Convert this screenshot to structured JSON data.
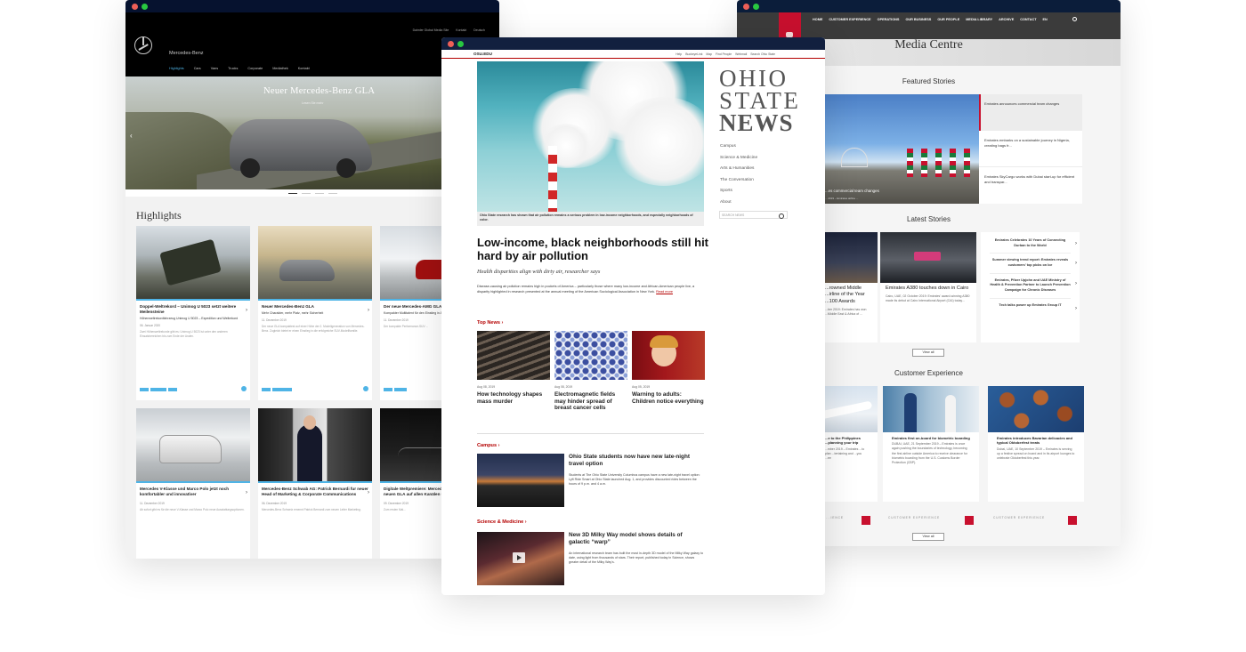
{
  "mercedes": {
    "brand": "Mercedes-Benz",
    "top_links": [
      "Daimler Global Media Site",
      "Kontakt",
      "Deutsch"
    ],
    "nav": [
      "Highlights",
      "Cars",
      "Vans",
      "Trucks",
      "Corporate",
      "Mediathek",
      "Kontakt"
    ],
    "hero_title": "Neuer Mercedes-Benz GLA",
    "hero_sub": "Lesen Sie mehr",
    "highlights_heading": "Highlights",
    "cards": [
      {
        "title": "Doppel-Weltrekord – Unimog U 5023 setzt weitere Meilensteine",
        "sub": "Höhenweltrekordfahrzeug Unimog U 5023 – Expedition und Weltrekord",
        "date": "06. Januar 2020",
        "text": "Zwei Höhenweltrekorde gibt es: Unimog U 5023 ist unter den anderen Einsatzbereichen bis zum Ende der Anden."
      },
      {
        "title": "Neuer Mercedes-Benz GLA",
        "sub": "Mehr Charakter, mehr Platz, mehr Sicherheit",
        "date": "11. Dezember 2019",
        "text": "Der neue GLA kompaktest auf einer Höhe der 2. Modellgeneration von Mercedes-Benz. Zugleich bietet er einen Einstieg in die erfolgreiche SUV-Modellfamilie."
      },
      {
        "title": "Der neue Mercedes-AMG GLA",
        "sub": "Kompakter Multitalent für den Einstieg in AMG Welt",
        "date": "11. Dezember 2019",
        "text": "Der kompakte Performance-SUV ..."
      },
      {
        "title": "Mercedes V-Klasse und Marco Polo jetzt noch komfortabler und innovativer",
        "sub": "",
        "date": "11. Dezember 2019",
        "text": "Ab sofort gibt es für die neue V-Klasse und Marco Polo neue Ausstattungsoptionen."
      },
      {
        "title": "Mercedes-Benz Schwab AG: Patrick Bernardi fur neuer Head of Marketing & Corporate Communications",
        "sub": "",
        "date": "06. Dezember 2019",
        "text": "Mercedes-Benz Schweiz ernennt Patrick Bernardi zum neuen Leiter Marketing."
      },
      {
        "title": "Digitale Weltpremiere: Mercedes-Benz präsentiert neuen GLA auf allen Kanälen und Social media",
        "sub": "",
        "date": "09. Dezember 2019",
        "text": "Zum ersten Mal..."
      }
    ]
  },
  "osu": {
    "topbar_label": "OSU.EDU",
    "top_links": [
      "Help",
      "BuckeyeLink",
      "Map",
      "Find People",
      "Webmail",
      "Search Ohio State"
    ],
    "logo": [
      "OHIO",
      "STATE",
      "NEWS"
    ],
    "menu": [
      "Campus",
      "Science & Medicine",
      "Arts & Humanities",
      "The Conversation",
      "Sports",
      "About"
    ],
    "search_placeholder": "SEARCH NEWS",
    "hero_caption": "Ohio State research has shown that air pollution remains a serious problem in low-income neighborhoods, and especially neighborhoods of color.",
    "headline": "Low-income, black neighborhoods still hit hard by air pollution",
    "dek": "Health disparities align with dirty air, researcher says",
    "body": "Disease-causing air pollution remains high in pockets of America – particularly those where many low-income and African-American people live, a disparity highlighted in research presented at the annual meeting of the American Sociological Association in New York.",
    "read_more": "Read more",
    "top_news_label": "Top News ›",
    "top_news": [
      {
        "date": "Aug 08, 2019",
        "title": "How technology shapes mass murder"
      },
      {
        "date": "Aug 08, 2019",
        "title": "Electromagnetic fields may hinder spread of breast cancer cells"
      },
      {
        "date": "Aug 05, 2019",
        "title": "Warning to adults: Children notice everything"
      }
    ],
    "campus_label": "Campus ›",
    "campus_story": {
      "title": "Ohio State students now have new late-night travel option",
      "text": "Students at The Ohio State University Columbus campus have a new late-night travel option: Lyft Ride Smart at Ohio State launched Aug. 1, and provides discounted rides between the hours of 9 p.m. and 4 a.m."
    },
    "science_label": "Science & Medicine ›",
    "science_story": {
      "title": "New 3D Milky Way model shows details of galactic “warp”",
      "text": "An international research team has built the most in-depth 3D model of the Milky Way galaxy to date, using light from thousands of stars. Their report, published today in Science, shows greater detail of the Milky Way's."
    }
  },
  "emirates": {
    "nav": [
      "HOME",
      "CUSTOMER EXPERIENCE",
      "OPERATIONS",
      "OUR BUSINESS",
      "OUR PEOPLE",
      "MEDIA LIBRARY",
      "ARCHIVE",
      "CONTACT",
      "EN"
    ],
    "page_title": "Media Centre",
    "featured_heading": "Featured Stories",
    "featured_caption": "...es commercial team changes",
    "featured_date": "... 2019 – Emirates airline ...",
    "featured_list": [
      "Emirates announces commercial team changes",
      "Emirates embarks on a sustainable journey in Nigeria, creating bags fr...",
      "Emirates SkyCargo works with Dubai start-up for efficient and transpar..."
    ],
    "latest_heading": "Latest Stories",
    "latest_cards": [
      {
        "title": "...rowned Middle ...irline of the Year ...100 Awards",
        "text": "...ber 2019: Emirates has won ...Middle East & Africa of ..."
      },
      {
        "title": "Emirates A380 touches down in Cairo",
        "text": "Cairo, UAE, 02 October 2019: Emirates' award-winning A380 made its debut at Cairo International Airport (CAI) today..."
      }
    ],
    "latest_list": [
      "Emirates Celebrates 10 Years of Connecting Durban to the World",
      "Summer viewing trend report: Emirates reveals customers' top picks on Ice",
      "Emirates, Pfizer Upjohn and UAE Ministry of Health & Prevention Partner to Launch Prevention Campaign for Chronic Diseases",
      "Tech talks power up Emirates Group IT"
    ],
    "view_all": "View all",
    "customer_heading": "Customer Experience",
    "customer_cards": [
      {
        "title": "...e to the Philippines ...planning your trip",
        "text": "...mber 2019 – Emirates ...to plan ...tertaining and ...you ...ee"
      },
      {
        "title": "Emirates first on-board for biometric boarding",
        "text": "DUBAI, UAE, 21 September 2019 – Emirates is once again pushing the boundaries of technology, becoming the first airline outside America to receive clearance for biometric boarding from the U.S. Customs Border Protection (CBP)."
      },
      {
        "title": "Emirates introduces Bavarian delicacies and typical Oktoberfest treats",
        "text": "Dubai, UAE, 10 September 2019 – Emirates is serving up a festive spread on board and in its airport lounges to celebrate Oktoberfest this year."
      }
    ],
    "customer_label": "CUSTOMER EXPERIENCE"
  }
}
